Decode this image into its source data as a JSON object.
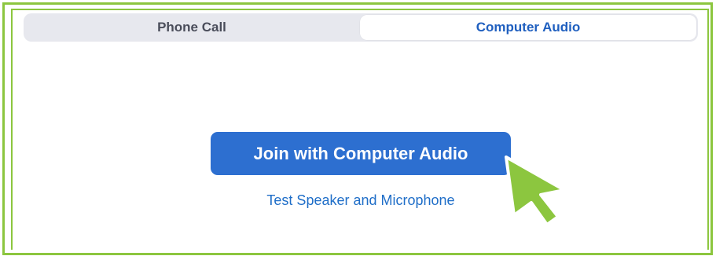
{
  "tabs": {
    "phone_call": "Phone Call",
    "computer_audio": "Computer Audio",
    "selected": "Computer Audio"
  },
  "main": {
    "join_button_label": "Join with Computer Audio",
    "test_link_label": "Test Speaker and Microphone"
  },
  "colors": {
    "frame_border": "#8cc63f",
    "tab_bar_bg": "#e7e8ee",
    "selected_tab_text": "#1f5fbf",
    "join_button_bg": "#2d6fd0",
    "link_text": "#1f6ec8",
    "pointer_fill": "#8cc63f"
  },
  "icons": {
    "pointer": "pointer-cursor-icon"
  }
}
